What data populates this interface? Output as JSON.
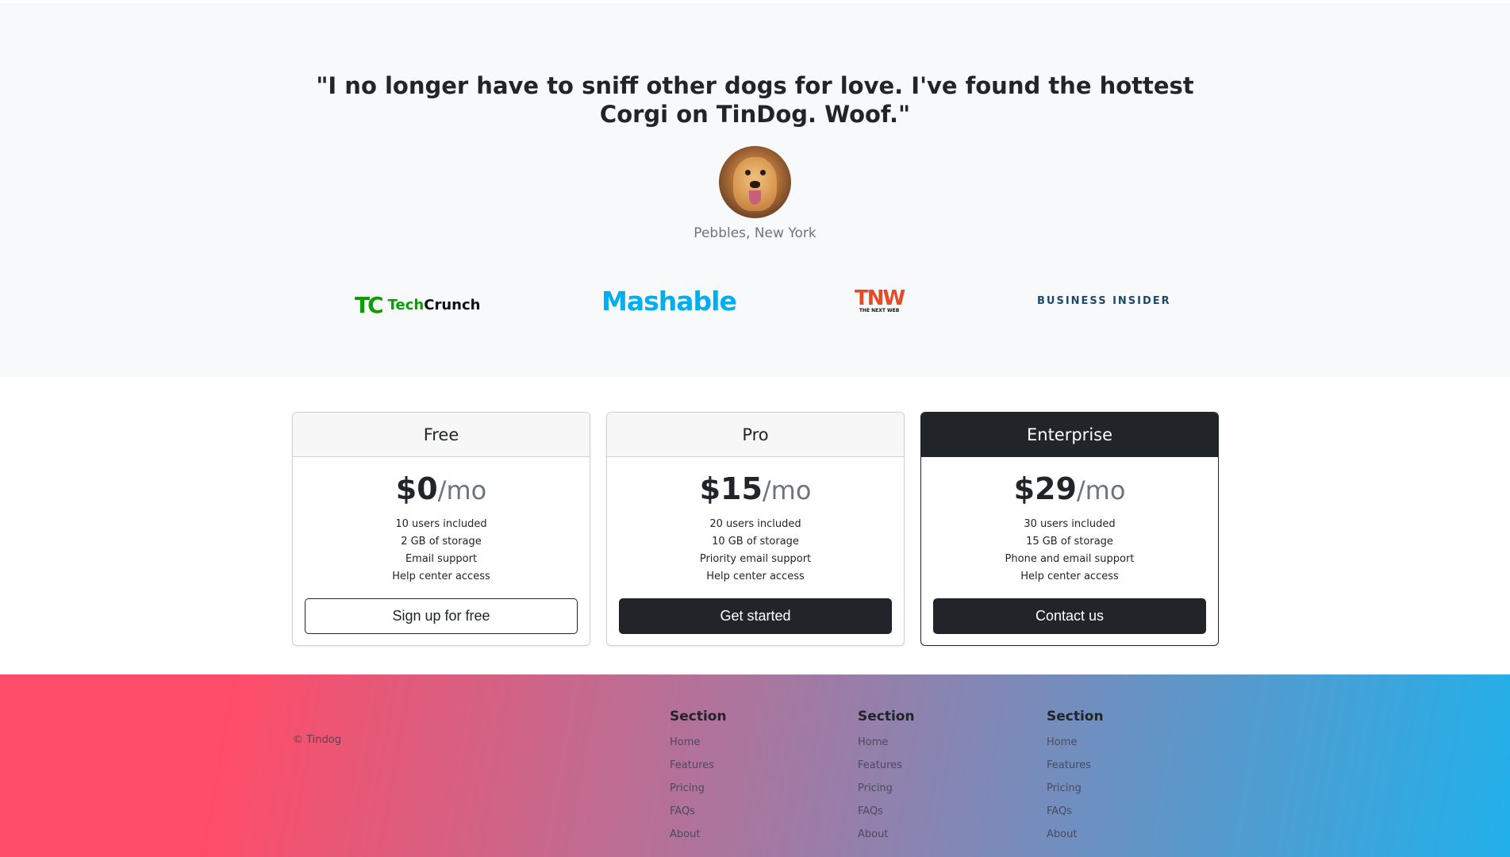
{
  "testimonial": {
    "quote": "\"I no longer have to sniff other dogs for love. I've found the hottest Corgi on TinDog. Woof.\"",
    "author": "Pebbles, New York"
  },
  "press": {
    "techcrunch": {
      "mark": "TC",
      "text_a": "Tech",
      "text_b": "Crunch"
    },
    "mashable": "Mashable",
    "tnw": {
      "big": "TNW",
      "small": "THE NEXT WEB"
    },
    "business_insider": "BUSINESS INSIDER"
  },
  "pricing": [
    {
      "name": "Free",
      "price": "$0",
      "period": "/mo",
      "features": [
        "10 users included",
        "2 GB of storage",
        "Email support",
        "Help center access"
      ],
      "button": "Sign up for free"
    },
    {
      "name": "Pro",
      "price": "$15",
      "period": "/mo",
      "features": [
        "20 users included",
        "10 GB of storage",
        "Priority email support",
        "Help center access"
      ],
      "button": "Get started"
    },
    {
      "name": "Enterprise",
      "price": "$29",
      "period": "/mo",
      "features": [
        "30 users included",
        "15 GB of storage",
        "Phone and email support",
        "Help center access"
      ],
      "button": "Contact us"
    }
  ],
  "footer": {
    "copyright": "© Tindog",
    "columns": [
      {
        "title": "Section",
        "links": [
          "Home",
          "Features",
          "Pricing",
          "FAQs",
          "About"
        ]
      },
      {
        "title": "Section",
        "links": [
          "Home",
          "Features",
          "Pricing",
          "FAQs",
          "About"
        ]
      },
      {
        "title": "Section",
        "links": [
          "Home",
          "Features",
          "Pricing",
          "FAQs",
          "About"
        ]
      }
    ]
  },
  "colors": {
    "testimonial_bg": "#f8f9fa",
    "dark": "#212529",
    "footer_gradient_start": "#ff4c68",
    "footer_gradient_end": "#21b0ea"
  }
}
